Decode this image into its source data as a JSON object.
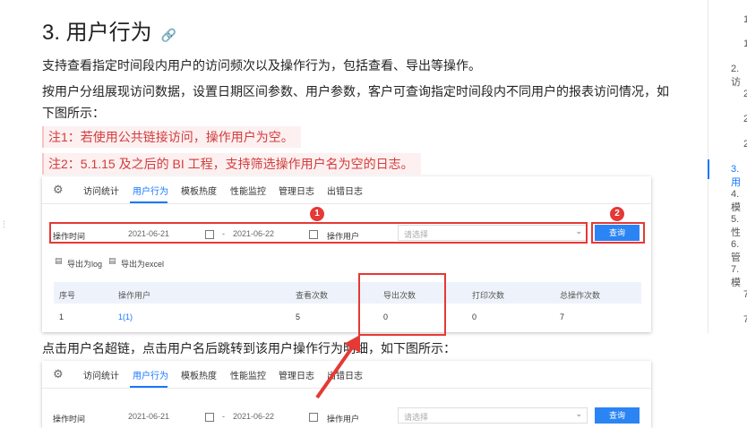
{
  "heading": {
    "title": "3. 用户行为",
    "link_icon": "link-icon"
  },
  "paragraphs": [
    "支持查看指定时间段内用户的访问频次以及操作行为，包括查看、导出等操作。",
    "按用户分组展现访问数据，设置日期区间参数、用户参数，客户可查询指定时间段内不同用户的报表访问情况，如",
    "下图所示："
  ],
  "notes": [
    "注1：若使用公共链接访问，操作用户为空。",
    "注2：5.1.15 及之后的 BI 工程，支持筛选操作用户名为空的日志。"
  ],
  "caption2": "点击用户名超链，点击用户名后跳转到该用户操作行为明细，如下图所示：",
  "screenshot1": {
    "tabs": [
      "访问统计",
      "用户行为",
      "模板热度",
      "性能监控",
      "管理日志",
      "出错日志"
    ],
    "active_tab": 1,
    "filter": {
      "label": "操作时间",
      "date_start": "2021-06-21",
      "date_end": "2021-06-22",
      "dash": "-",
      "user_label": "操作用户",
      "user_placeholder": "请选择",
      "query_button": "查询"
    },
    "export": {
      "log": "导出为log",
      "excel": "导出为excel"
    },
    "table": {
      "headers": [
        "序号",
        "操作用户",
        "查看次数",
        "导出次数",
        "打印次数",
        "总操作次数"
      ],
      "rows": [
        [
          "1",
          "1(1)",
          "5",
          "0",
          "0",
          "7"
        ]
      ]
    },
    "badges": [
      "1",
      "2"
    ]
  },
  "screenshot2": {
    "tabs": [
      "访问统计",
      "用户行为",
      "模板热度",
      "性能监控",
      "管理日志",
      "出错日志"
    ],
    "active_tab": 1,
    "filter": {
      "label": "操作时间",
      "date_start": "2021-06-21",
      "date_end": "2021-06-22",
      "dash": "-",
      "user_label": "操作用户",
      "user_placeholder": "请选择",
      "query_button": "查询"
    }
  },
  "toc": {
    "items": [
      "1",
      "1",
      "2. 访",
      "2",
      "2",
      "2",
      "3. 用",
      "4. 模",
      "5. 性",
      "6. 管",
      "7. 模",
      "7",
      "7"
    ],
    "active_index": 6
  },
  "colors": {
    "accent": "#1677ff",
    "annotation_red": "#e53935",
    "note_text": "#d23c3c"
  }
}
